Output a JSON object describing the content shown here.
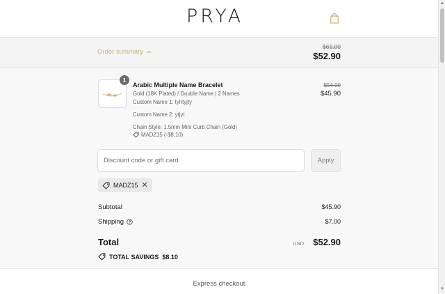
{
  "header": {
    "logo": "PRYA",
    "cart_icon": "shopping-bag-icon"
  },
  "summary": {
    "toggle_label": "Order summary",
    "toggle_icon": "chevron-up-icon",
    "original_total": "$61.00",
    "total": "$52.90"
  },
  "product": {
    "quantity": "1",
    "title": "Arabic Multiple Name Bracelet",
    "variant": "Gold (18K Plated) / Double Name | 2 Names",
    "custom_name_1": "Custom Name 1: tyhtyjty",
    "custom_name_2": "Custom Name 2: ytjyt",
    "chain_style": "Chain Style: 1.5mm Mini Curb Chain (Gold)",
    "discount": "MADZ15 (-$8.10)",
    "original_price": "$54.00",
    "price": "$45.90"
  },
  "discount_form": {
    "placeholder": "Discount code or gift card",
    "apply_label": "Apply"
  },
  "applied_code": {
    "code": "MADZ15"
  },
  "totals": {
    "subtotal_label": "Subtotal",
    "subtotal_value": "$45.90",
    "shipping_label": "Shipping",
    "shipping_value": "$7.00",
    "total_label": "Total",
    "currency": "USD",
    "total_value": "$52.90",
    "savings_label": "TOTAL SAVINGS",
    "savings_value": "$8.10"
  },
  "footer": {
    "express_label": "Express checkout"
  },
  "colors": {
    "accent": "#c9b27a",
    "summary_bg": "#f4f4f4",
    "content_bg": "#f8f8f8"
  }
}
